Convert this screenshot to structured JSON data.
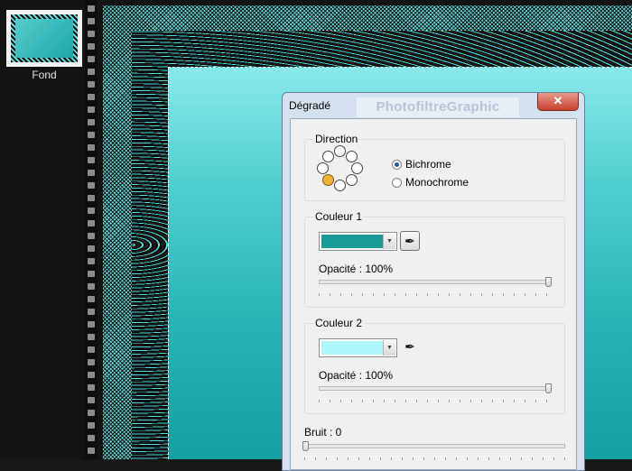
{
  "layers": {
    "items": [
      {
        "name": "Fond"
      }
    ]
  },
  "dialog": {
    "title": "Dégradé",
    "watermark": "PhotofiltreGraphic",
    "close_symbol": "✕",
    "direction": {
      "title": "Direction",
      "options": [
        "Bichrome",
        "Monochrome"
      ],
      "selected": "Bichrome"
    },
    "color1": {
      "title": "Couleur 1",
      "color": "#1a9a99",
      "opacity_label": "Opacité : 100%",
      "opacity_value": 100
    },
    "color2": {
      "title": "Couleur 2",
      "color": "#aef8fb",
      "opacity_label": "Opacité : 100%",
      "opacity_value": 100
    },
    "noise": {
      "label": "Bruit : 0",
      "value": 0
    },
    "icons": {
      "picker": "eyedropper-icon",
      "dropdown": "chevron-down-icon"
    }
  }
}
